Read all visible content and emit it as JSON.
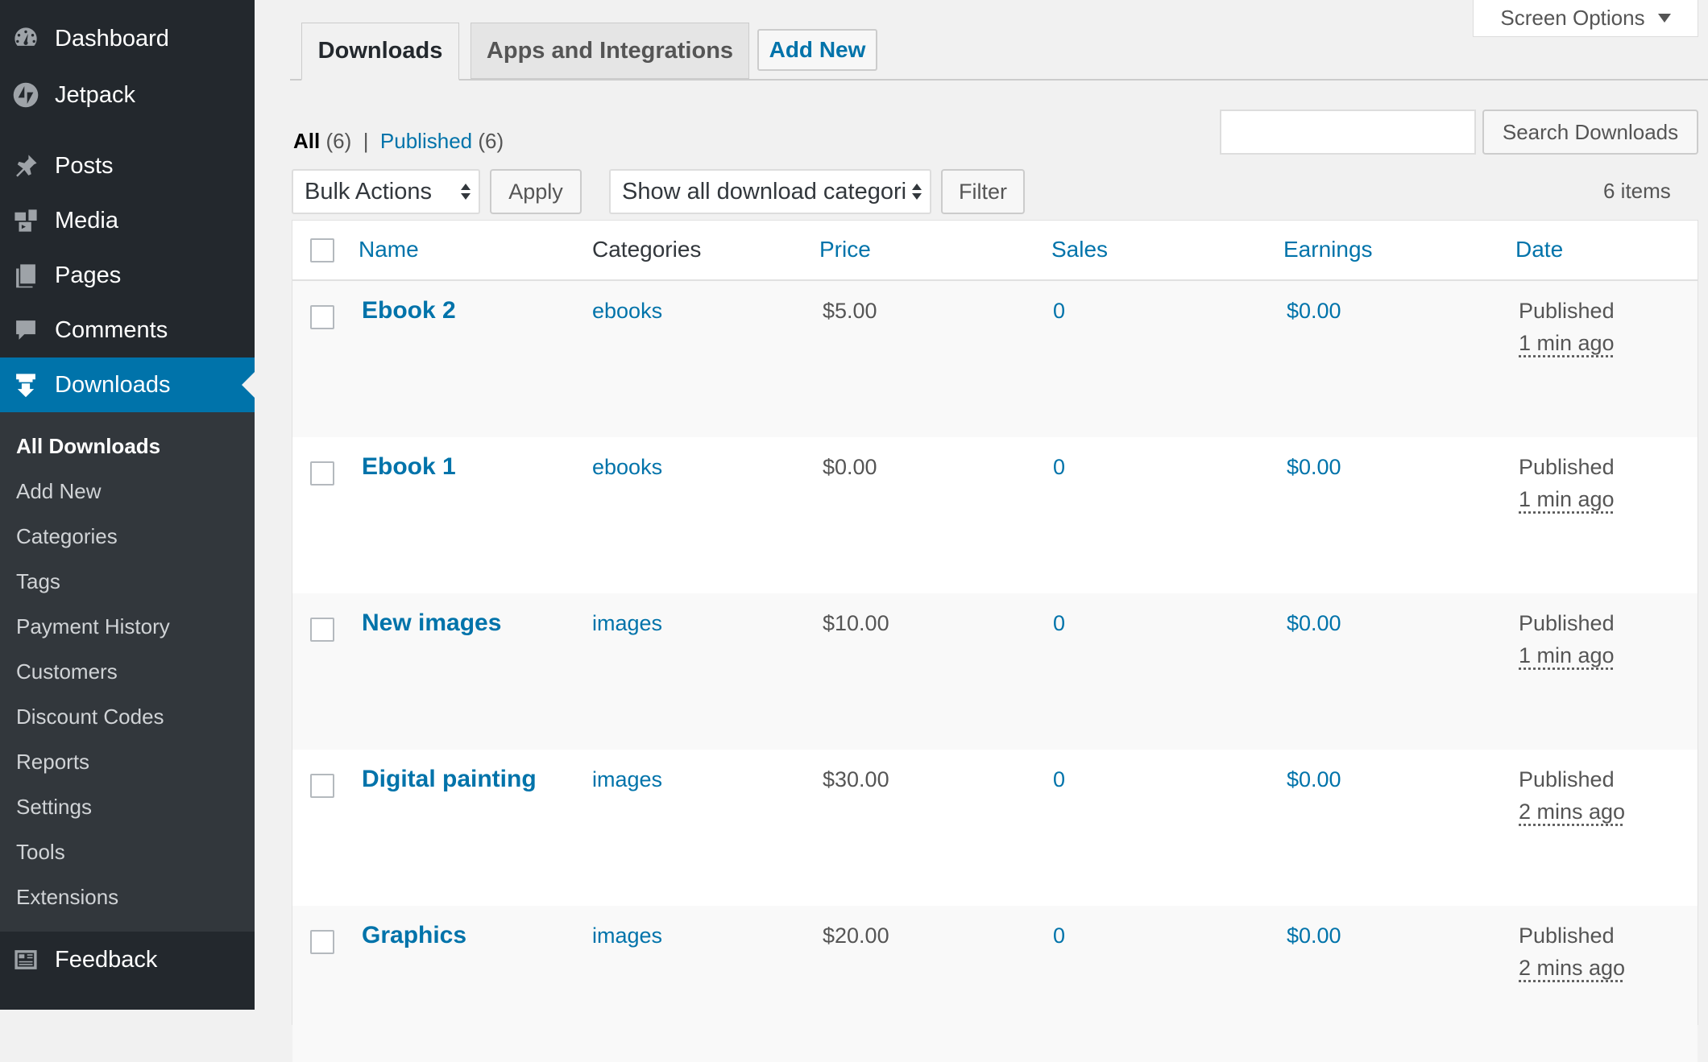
{
  "sidebar": {
    "top_items": [
      {
        "label": "Dashboard",
        "icon": "dashboard-icon"
      },
      {
        "label": "Jetpack",
        "icon": "jetpack-icon"
      },
      {
        "label": "Posts",
        "icon": "pin-icon"
      },
      {
        "label": "Media",
        "icon": "media-icon"
      },
      {
        "label": "Pages",
        "icon": "pages-icon"
      },
      {
        "label": "Comments",
        "icon": "comment-icon"
      },
      {
        "label": "Downloads",
        "icon": "download-icon"
      }
    ],
    "submenu": [
      "All Downloads",
      "Add New",
      "Categories",
      "Tags",
      "Payment History",
      "Customers",
      "Discount Codes",
      "Reports",
      "Settings",
      "Tools",
      "Extensions"
    ],
    "feedback": {
      "label": "Feedback",
      "icon": "feedback-icon"
    }
  },
  "screen_options": "Screen Options",
  "tabs": [
    "Downloads",
    "Apps and Integrations"
  ],
  "add_new": "Add New",
  "views": {
    "all_label": "All",
    "all_count": "(6)",
    "separator": "|",
    "published_label": "Published",
    "published_count": "(6)"
  },
  "search": {
    "value": "",
    "button": "Search Downloads"
  },
  "bulk_actions": {
    "selected": "Bulk Actions",
    "apply": "Apply"
  },
  "category_filter": {
    "selected": "Show all download categori",
    "button": "Filter"
  },
  "items_count": "6 items",
  "table": {
    "columns": [
      "Name",
      "Categories",
      "Price",
      "Sales",
      "Earnings",
      "Date"
    ],
    "rows": [
      {
        "name": "Ebook 2",
        "category": "ebooks",
        "price": "$5.00",
        "sales": "0",
        "earnings": "$0.00",
        "status": "Published",
        "time": "1 min ago"
      },
      {
        "name": "Ebook 1",
        "category": "ebooks",
        "price": "$0.00",
        "sales": "0",
        "earnings": "$0.00",
        "status": "Published",
        "time": "1 min ago"
      },
      {
        "name": "New images",
        "category": "images",
        "price": "$10.00",
        "sales": "0",
        "earnings": "$0.00",
        "status": "Published",
        "time": "1 min ago"
      },
      {
        "name": "Digital painting",
        "category": "images",
        "price": "$30.00",
        "sales": "0",
        "earnings": "$0.00",
        "status": "Published",
        "time": "2 mins ago"
      },
      {
        "name": "Graphics",
        "category": "images",
        "price": "$20.00",
        "sales": "0",
        "earnings": "$0.00",
        "status": "Published",
        "time": "2 mins ago"
      }
    ]
  },
  "colors": {
    "sidebar": "#23282d",
    "submenu": "#32373c",
    "accent": "#0073aa",
    "page_bg": "#f1f1f1"
  }
}
